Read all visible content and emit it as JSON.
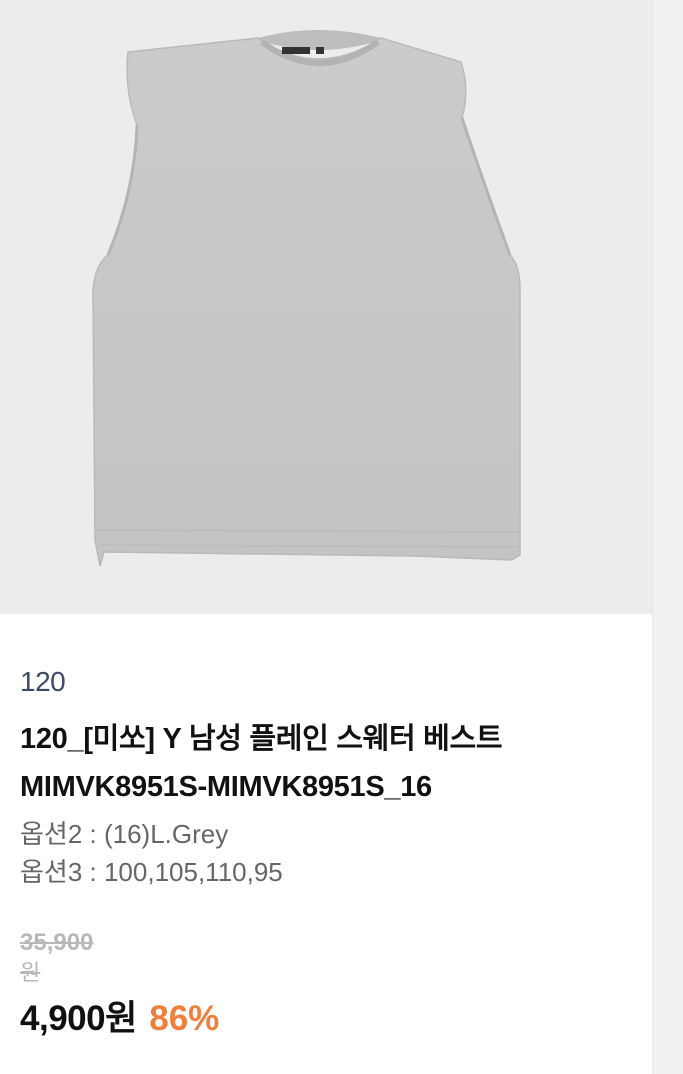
{
  "product": {
    "brand": "120",
    "title_line1": "120_[미쏘] Y 남성 플레인 스웨터 베스트",
    "title_line2": "MIMVK8951S-MIMVK8951S_16",
    "options": [
      {
        "label": "옵션2",
        "value": "(16)L.Grey",
        "display": "옵션2 : (16)L.Grey"
      },
      {
        "label": "옵션3",
        "value": "100,105,110,95",
        "display": "옵션3 : 100,105,110,95"
      }
    ],
    "original_price": "35,900",
    "original_price_unit": "원",
    "sale_price": "4,900원",
    "discount": "86%",
    "image": {
      "icon": "sleeveless-sweater-vest-photo",
      "garment_color": "#c9c9c9",
      "background_color": "#ececec"
    }
  },
  "colors": {
    "brand": "#3d4a66",
    "title": "#111111",
    "option": "#666666",
    "original_price": "#b8b8b8",
    "discount": "#ef7f3a"
  }
}
